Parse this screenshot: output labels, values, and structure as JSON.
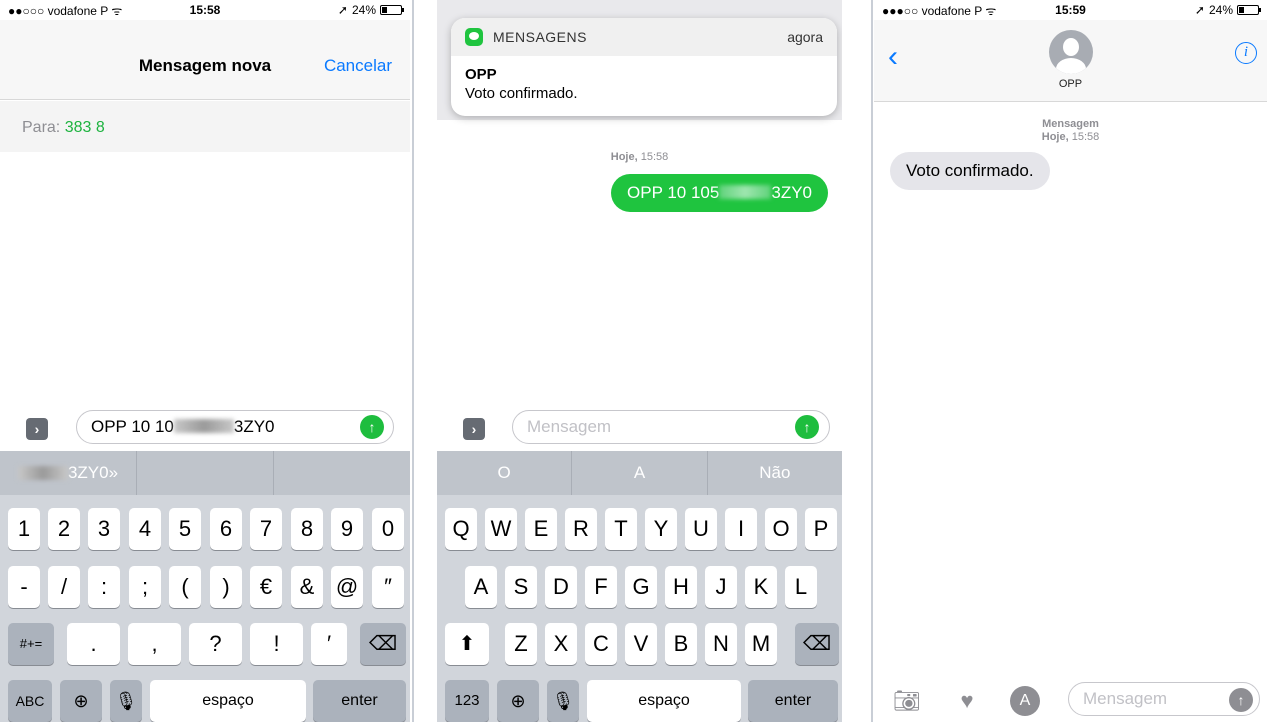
{
  "left": {
    "status": {
      "carrier": "●●○○○ vodafone P ᯤ",
      "time": "15:58",
      "battery": "24%",
      "battery_level": 0.24
    },
    "nav": {
      "title": "Mensagem nova",
      "cancel": "Cancelar"
    },
    "to": {
      "label": "Para:",
      "value": "383 8"
    },
    "input": {
      "text_start": "OPP 10 10",
      "text_end": "3ZY0"
    },
    "suggestions": [
      "3ZY0»",
      "",
      ""
    ],
    "keys_row1": [
      "1",
      "2",
      "3",
      "4",
      "5",
      "6",
      "7",
      "8",
      "9",
      "0"
    ],
    "keys_row2": [
      "-",
      "/",
      ":",
      ";",
      "(",
      ")",
      "€",
      "&",
      "@",
      "″"
    ],
    "keys_row3": [
      "#+=",
      ".",
      ",",
      "?",
      "!",
      "′"
    ],
    "keys_row4": {
      "abc": "ABC",
      "space": "espaço",
      "enter": "enter"
    }
  },
  "middle": {
    "notification": {
      "app": "MENSAGENS",
      "when": "agora",
      "sender": "OPP",
      "body": "Voto confirmado."
    },
    "timestamp": {
      "day": "Hoje,",
      "time": "15:58"
    },
    "bubble": {
      "text_start": "OPP 10 105",
      "text_end": "3ZY0"
    },
    "input": {
      "placeholder": "Mensagem"
    },
    "suggestions": [
      "O",
      "A",
      "Não"
    ],
    "keys_row1": [
      "Q",
      "W",
      "E",
      "R",
      "T",
      "Y",
      "U",
      "I",
      "O",
      "P"
    ],
    "keys_row2": [
      "A",
      "S",
      "D",
      "F",
      "G",
      "H",
      "J",
      "K",
      "L"
    ],
    "keys_row3": [
      "Z",
      "X",
      "C",
      "V",
      "B",
      "N",
      "M"
    ],
    "keys_row4": {
      "num": "123",
      "space": "espaço",
      "enter": "enter"
    }
  },
  "right": {
    "status": {
      "carrier": "●●●○○ vodafone P ᯤ",
      "time": "15:59",
      "battery": "24%",
      "battery_level": 0.24
    },
    "contact": {
      "name": "OPP"
    },
    "timestamp": {
      "label": "Mensagem",
      "day": "Hoje,",
      "time": "15:58"
    },
    "bubble": {
      "text": "Voto confirmado."
    },
    "input": {
      "placeholder": "Mensagem"
    }
  },
  "colors": {
    "accent": "#0a7aff",
    "green": "#1fc43f",
    "keyboard": "#d1d5db"
  },
  "icons": [
    "expand-icon",
    "send-arrow-icon",
    "globe-icon",
    "microphone-icon",
    "delete-icon",
    "shift-icon",
    "back-chevron-icon",
    "info-icon",
    "camera-icon",
    "digital-touch-icon",
    "app-store-icon",
    "avatar-icon",
    "messages-app-icon"
  ]
}
